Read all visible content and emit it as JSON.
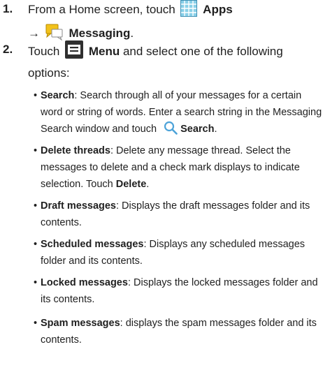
{
  "steps": [
    {
      "number": "1.",
      "line1_prefix": "From a Home screen, touch",
      "apps_label": "Apps",
      "arrow": "→",
      "messaging_label": "Messaging",
      "period": "."
    },
    {
      "number": "2.",
      "prefix": "Touch",
      "menu_label": "Menu",
      "suffix": "and select one of the following options:"
    }
  ],
  "options": [
    {
      "term": "Search",
      "desc_before": ": Search through all of your messages for a certain word or string of words. Enter a search string in the Messaging Search window and touch",
      "action": "Search",
      "desc_after": "."
    },
    {
      "term": "Delete threads",
      "desc_before": ": Delete any message thread. Select the messages to delete and a check mark displays to indicate selection. Touch",
      "action": "Delete",
      "desc_after": "."
    },
    {
      "term": "Draft messages",
      "desc": ": Displays the draft messages folder and its contents."
    },
    {
      "term": "Scheduled messages",
      "desc": ": Displays any scheduled messages folder and its contents."
    },
    {
      "term": "Locked messages",
      "desc": ": Displays the locked messages folder and its contents."
    },
    {
      "term": "Spam messages",
      "desc": ": displays the spam messages folder and its contents."
    }
  ],
  "bullet_char": "•",
  "icons": {
    "apps": "apps-grid-icon",
    "messaging": "messaging-icon",
    "menu": "menu-icon",
    "search": "search-icon"
  },
  "colors": {
    "apps_icon": "#8ad0e8",
    "messaging_icon": "#f2c21b",
    "menu_icon": "#2f2f2f",
    "search_icon": "#4da3d9"
  }
}
